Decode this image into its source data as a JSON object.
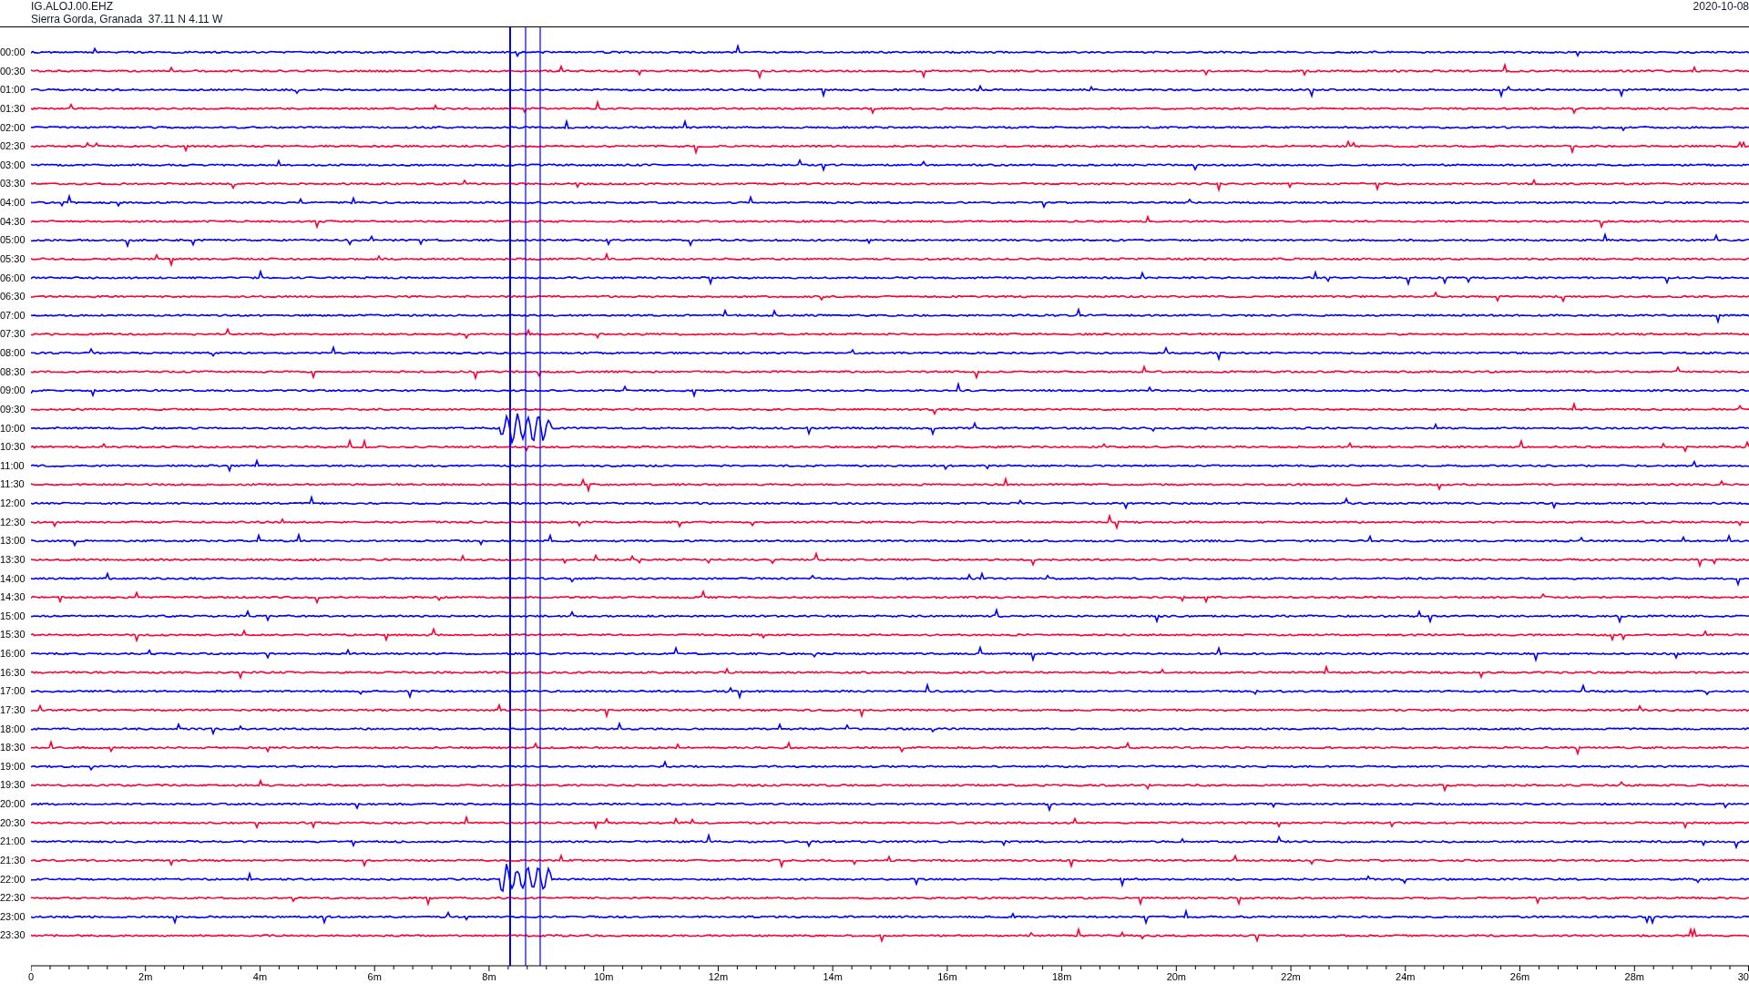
{
  "header": {
    "station": "IG.ALOJ.00.EHZ",
    "location": "Sierra Gorda, Granada  37.11 N 4.11 W",
    "date": "2020-10-08"
  },
  "rows": [
    {
      "label": "00:00",
      "color": "#0000ff"
    },
    {
      "label": "00:30",
      "color": "#ff0033"
    },
    {
      "label": "01:00",
      "color": "#0000ff"
    },
    {
      "label": "01:30",
      "color": "#ff0033"
    },
    {
      "label": "02:00",
      "color": "#0000ff"
    },
    {
      "label": "02:30",
      "color": "#ff0033"
    },
    {
      "label": "03:00",
      "color": "#0000ff"
    },
    {
      "label": "03:30",
      "color": "#ff0033"
    },
    {
      "label": "04:00",
      "color": "#0000ff"
    },
    {
      "label": "04:30",
      "color": "#ff0033"
    },
    {
      "label": "05:00",
      "color": "#0000ff"
    },
    {
      "label": "05:30",
      "color": "#ff0033"
    },
    {
      "label": "06:00",
      "color": "#0000ff"
    },
    {
      "label": "06:30",
      "color": "#ff0033"
    },
    {
      "label": "07:00",
      "color": "#0000ff"
    },
    {
      "label": "07:30",
      "color": "#ff0033"
    },
    {
      "label": "08:00",
      "color": "#0000ff"
    },
    {
      "label": "08:30",
      "color": "#ff0033"
    },
    {
      "label": "09:00",
      "color": "#0000ff"
    },
    {
      "label": "09:30",
      "color": "#ff0033"
    },
    {
      "label": "10:00",
      "color": "#0000ff"
    },
    {
      "label": "10:30",
      "color": "#ff0033"
    },
    {
      "label": "11:00",
      "color": "#0000ff"
    },
    {
      "label": "11:30",
      "color": "#ff0033"
    },
    {
      "label": "12:00",
      "color": "#0000ff"
    },
    {
      "label": "12:30",
      "color": "#ff0033"
    },
    {
      "label": "13:00",
      "color": "#0000ff"
    },
    {
      "label": "13:30",
      "color": "#ff0033"
    },
    {
      "label": "14:00",
      "color": "#0000ff"
    },
    {
      "label": "14:30",
      "color": "#ff0033"
    },
    {
      "label": "15:00",
      "color": "#0000ff"
    },
    {
      "label": "15:30",
      "color": "#ff0033"
    },
    {
      "label": "16:00",
      "color": "#0000ff"
    },
    {
      "label": "16:30",
      "color": "#ff0033"
    },
    {
      "label": "17:00",
      "color": "#0000ff"
    },
    {
      "label": "17:30",
      "color": "#ff0033"
    },
    {
      "label": "18:00",
      "color": "#0000ff"
    },
    {
      "label": "18:30",
      "color": "#ff0033"
    },
    {
      "label": "19:00",
      "color": "#0000ff"
    },
    {
      "label": "19:30",
      "color": "#ff0033"
    },
    {
      "label": "20:00",
      "color": "#0000ff"
    },
    {
      "label": "20:30",
      "color": "#ff0033"
    },
    {
      "label": "21:00",
      "color": "#0000ff"
    },
    {
      "label": "21:30",
      "color": "#ff0033"
    },
    {
      "label": "22:00",
      "color": "#0000ff"
    },
    {
      "label": "22:30",
      "color": "#ff0033"
    },
    {
      "label": "23:00",
      "color": "#0000ff"
    },
    {
      "label": "23:30",
      "color": "#ff0033"
    }
  ],
  "x_axis": {
    "ticks": [
      "0",
      "2m",
      "4m",
      "6m",
      "8m",
      "10m",
      "12m",
      "14m",
      "16m",
      "18m",
      "20m",
      "22m",
      "24m",
      "26m",
      "28m",
      "30"
    ]
  }
}
